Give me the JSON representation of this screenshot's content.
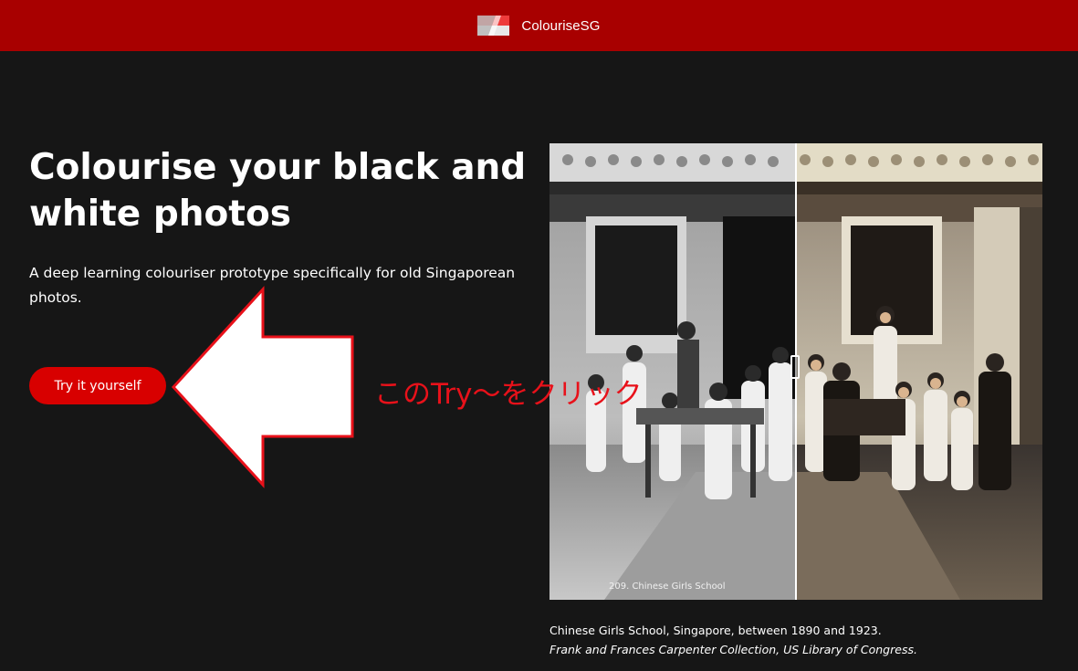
{
  "header": {
    "brand_name": "ColouriseSG",
    "logo_icon": "singapore-flag-icon",
    "background": "#a80000"
  },
  "hero": {
    "title": "Colourise your black and white photos",
    "description": "A deep learning colouriser prototype specifically for old Singaporean photos.",
    "cta_label": "Try it yourself",
    "cta_color": "#d80000"
  },
  "annotation": {
    "text": "このTry～をクリック",
    "color": "#e8111a",
    "arrow_icon": "left-arrow-icon"
  },
  "photo": {
    "bw_photo_label": "209. Chinese Girls School",
    "compare_handle_icon": "drag-handle-icon"
  },
  "caption": {
    "line1": "Chinese Girls School, Singapore, between 1890 and 1923.",
    "credit": "Frank and Frances Carpenter Collection, US Library of Congress."
  },
  "colors": {
    "page_background": "#161616",
    "accent": "#a80000"
  }
}
